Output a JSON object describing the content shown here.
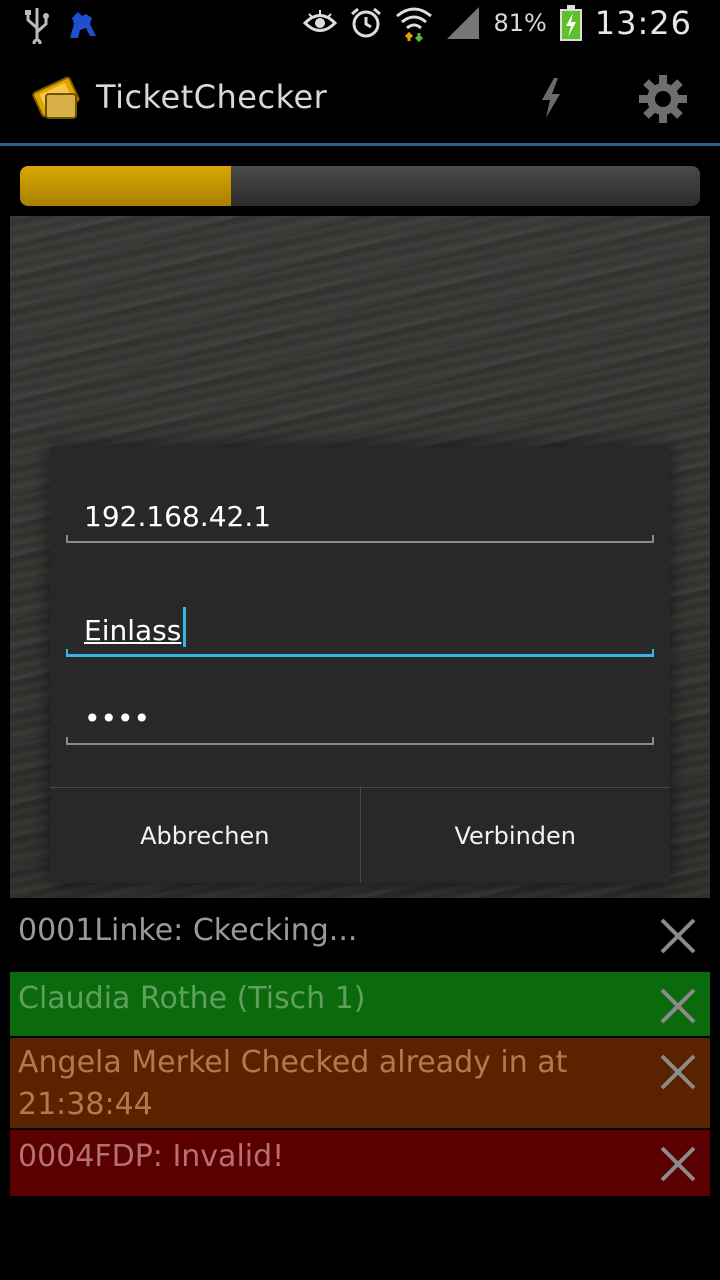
{
  "status_bar": {
    "battery": "81%",
    "time": "13:26",
    "icons": [
      "usb-icon",
      "app-notification-icon",
      "eye-icon",
      "alarm-icon",
      "wifi-icon",
      "signal-icon",
      "battery-charging-icon"
    ]
  },
  "action_bar": {
    "title": "TicketChecker",
    "logo_text": "Ticket",
    "icons": [
      "ticket-logo-icon",
      "flash-icon",
      "settings-gear-icon"
    ]
  },
  "progress": {
    "value_fraction": 0.31,
    "color": "#d8a800"
  },
  "dialog": {
    "server_value": "192.168.42.1",
    "user_value": "Einlass",
    "password_value": "••••",
    "cancel_label": "Abbrechen",
    "connect_label": "Verbinden",
    "focus_color": "#33b5e5"
  },
  "log": {
    "items": [
      {
        "text": "0001Linke: Ckecking...",
        "bg": "#000000",
        "fg": "#9a9a9a"
      },
      {
        "text": "Claudia Rothe (Tisch 1)",
        "bg": "#0b6a0b",
        "fg": "#5fa05f"
      },
      {
        "text": "Angela Merkel Checked already in at 21:38:44",
        "bg": "#5b2200",
        "fg": "#b07a4e"
      },
      {
        "text": "0004FDP: Invalid!",
        "bg": "#5a0000",
        "fg": "#b57070"
      }
    ]
  }
}
